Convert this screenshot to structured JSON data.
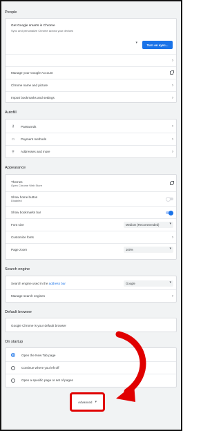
{
  "people": {
    "title": "People",
    "sync_title": "Get Google smarts in Chrome",
    "sync_subtitle": "Sync and personalize Chrome across your devices",
    "sync_button": "Turn on sync...",
    "rows": [
      "Manage your Google Account",
      "Chrome name and picture",
      "Import bookmarks and settings"
    ]
  },
  "autofill": {
    "title": "Autofill",
    "rows": [
      {
        "icon": "key-icon",
        "glyph": "⚷",
        "label": "Passwords"
      },
      {
        "icon": "credit-card-icon",
        "glyph": "▭",
        "label": "Payment methods"
      },
      {
        "icon": "location-pin-icon",
        "glyph": "⚲",
        "label": "Addresses and more"
      }
    ]
  },
  "appearance": {
    "title": "Appearance",
    "themes_label": "Themes",
    "themes_sub": "Open Chrome Web Store",
    "home_label": "Show home button",
    "home_sub": "Disabled",
    "bookmarks_label": "Show bookmarks bar",
    "font_size_label": "Font size",
    "font_size_value": "Medium (Recommended)",
    "customize_fonts_label": "Customize fonts",
    "page_zoom_label": "Page zoom",
    "page_zoom_value": "100%"
  },
  "search_engine": {
    "title": "Search engine",
    "used_label_prefix": "Search engine used in the",
    "used_label_link": "address bar",
    "engine_value": "Google",
    "manage_label": "Manage search engines"
  },
  "default_browser": {
    "title": "Default browser",
    "status": "Google Chrome is your default browser"
  },
  "on_startup": {
    "title": "On startup",
    "options": [
      "Open the New Tab page",
      "Continue where you left off",
      "Open a specific page or set of pages"
    ],
    "selected_index": 0
  },
  "advanced": {
    "label": "Advanced"
  },
  "colors": {
    "accent": "#1a73e8",
    "annotation": "#e00000"
  }
}
